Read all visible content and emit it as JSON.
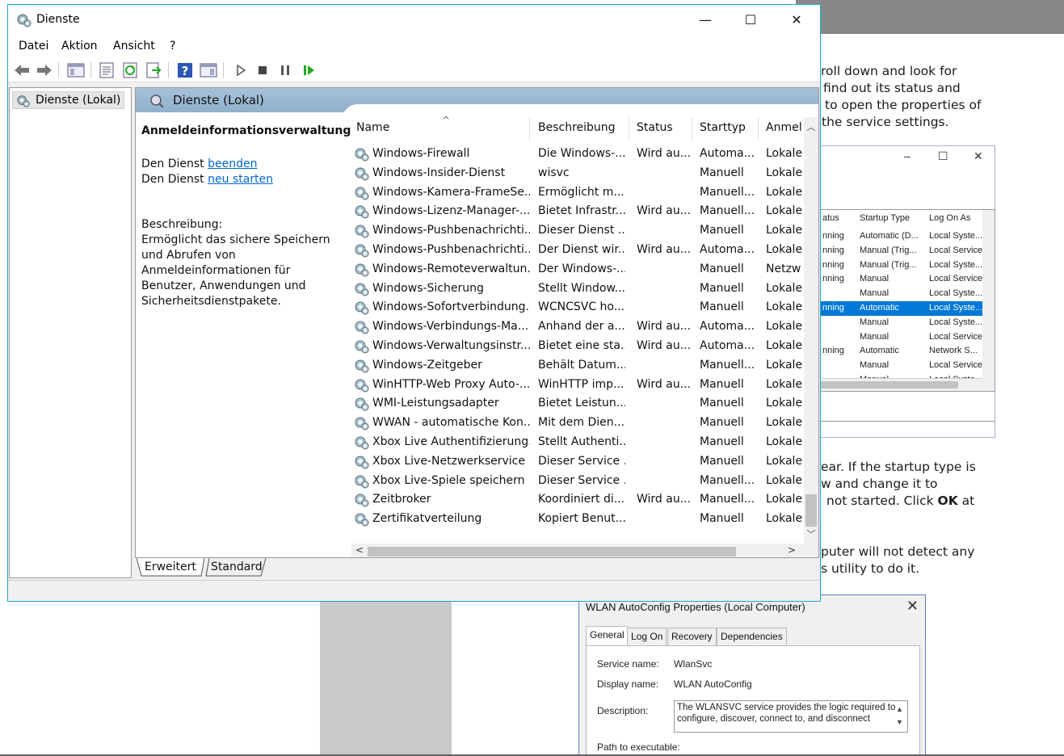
{
  "background": {
    "text_lines_top": [
      "roll down and look for",
      "find out its status and",
      "to open the properties of",
      "the service settings."
    ],
    "text_lines_mid_a": "ear. If the startup type is",
    "text_lines_mid_b": "w and change it to",
    "text_lines_mid_c_pre": "not started. Click ",
    "text_lines_mid_c_bold": "OK",
    "text_lines_mid_c_post": " at",
    "text_lines_bottom": [
      "puter will not detect any",
      "s utility to do it."
    ],
    "mini_window": {
      "controls": [
        "–",
        "☐",
        "✕"
      ],
      "headers": [
        "atus",
        "Startup Type",
        "Log On As"
      ],
      "rows": [
        {
          "status": "nning",
          "startup": "Automatic (D...",
          "logon": "Local Syste..."
        },
        {
          "status": "nning",
          "startup": "Manual (Trig...",
          "logon": "Local Service"
        },
        {
          "status": "nning",
          "startup": "Manual (Trig...",
          "logon": "Local Syste..."
        },
        {
          "status": "nning",
          "startup": "Manual",
          "logon": "Local Service"
        },
        {
          "status": "",
          "startup": "Manual",
          "logon": "Local Syste..."
        },
        {
          "status": "nning",
          "startup": "Automatic",
          "logon": "Local Syste..."
        },
        {
          "status": "",
          "startup": "Manual",
          "logon": "Local Syste..."
        },
        {
          "status": "",
          "startup": "Manual",
          "logon": "Local Service"
        },
        {
          "status": "nning",
          "startup": "Automatic",
          "logon": "Network S..."
        },
        {
          "status": "",
          "startup": "Manual",
          "logon": "Local Service"
        },
        {
          "status": "",
          "startup": "Manual",
          "logon": "Local Syste..."
        }
      ],
      "selected_index": 5
    },
    "wlan_dialog": {
      "title": "WLAN AutoConfig Properties (Local Computer)",
      "close": "✕",
      "tabs": [
        "General",
        "Log On",
        "Recovery",
        "Dependencies"
      ],
      "service_name_label": "Service name:",
      "service_name_value": "WlanSvc",
      "display_name_label": "Display name:",
      "display_name_value": "WLAN AutoConfig",
      "description_label": "Description:",
      "description_value": "The WLANSVC service provides the logic required to configure, discover, connect to, and disconnect",
      "path_label": "Path to executable:"
    }
  },
  "window": {
    "title": "Dienste",
    "minimize": "—",
    "maximize": "☐",
    "close": "✕",
    "accent": "#1aa8c7"
  },
  "menu": [
    "Datei",
    "Aktion",
    "Ansicht",
    "?"
  ],
  "tree": {
    "root_label": "Dienste (Lokal)"
  },
  "pane": {
    "header": "Dienste (Lokal)",
    "detail": {
      "title": "Anmeldeinformationsverwaltung",
      "stop_prefix": "Den Dienst ",
      "stop_link": "beenden",
      "restart_prefix": "Den Dienst ",
      "restart_link": "neu starten",
      "desc_label": "Beschreibung:",
      "desc_text": "Ermöglicht das sichere Speichern und Abrufen von Anmeldeinformationen für Benutzer, Anwendungen und Sicherheitsdienstpakete."
    }
  },
  "list": {
    "columns": [
      "Name",
      "Beschreibung",
      "Status",
      "Starttyp",
      "Anmel"
    ],
    "rows": [
      {
        "name": "Windows-Firewall",
        "desc": "Die Windows-...",
        "status": "Wird au...",
        "start": "Automa...",
        "logon": "Lokale"
      },
      {
        "name": "Windows-Insider-Dienst",
        "desc": "wisvc",
        "status": "",
        "start": "Manuell",
        "logon": "Lokale"
      },
      {
        "name": "Windows-Kamera-FrameSe...",
        "desc": "Ermöglicht m...",
        "status": "",
        "start": "Manuell...",
        "logon": "Lokale"
      },
      {
        "name": "Windows-Lizenz-Manager-...",
        "desc": "Bietet Infrastr...",
        "status": "Wird au...",
        "start": "Manuell...",
        "logon": "Lokale"
      },
      {
        "name": "Windows-Pushbenachrichti...",
        "desc": "Dieser Dienst ...",
        "status": "",
        "start": "Manuell",
        "logon": "Lokale"
      },
      {
        "name": "Windows-Pushbenachrichti...",
        "desc": "Der Dienst wir...",
        "status": "Wird au...",
        "start": "Automa...",
        "logon": "Lokale"
      },
      {
        "name": "Windows-Remoteverwaltun...",
        "desc": "Der Windows-...",
        "status": "",
        "start": "Manuell",
        "logon": "Netzw"
      },
      {
        "name": "Windows-Sicherung",
        "desc": "Stellt Window...",
        "status": "",
        "start": "Manuell",
        "logon": "Lokale"
      },
      {
        "name": "Windows-Sofortverbindung...",
        "desc": "WCNCSVC ho...",
        "status": "",
        "start": "Manuell",
        "logon": "Lokale"
      },
      {
        "name": "Windows-Verbindungs-Ma...",
        "desc": "Anhand der a...",
        "status": "Wird au...",
        "start": "Automa...",
        "logon": "Lokale"
      },
      {
        "name": "Windows-Verwaltungsinstr...",
        "desc": "Bietet eine sta...",
        "status": "Wird au...",
        "start": "Automa...",
        "logon": "Lokale"
      },
      {
        "name": "Windows-Zeitgeber",
        "desc": "Behält Datum...",
        "status": "",
        "start": "Manuell...",
        "logon": "Lokale"
      },
      {
        "name": "WinHTTP-Web Proxy Auto-...",
        "desc": "WinHTTP imp...",
        "status": "Wird au...",
        "start": "Manuell",
        "logon": "Lokale"
      },
      {
        "name": "WMI-Leistungsadapter",
        "desc": "Bietet Leistun...",
        "status": "",
        "start": "Manuell",
        "logon": "Lokale"
      },
      {
        "name": "WWAN - automatische Kon...",
        "desc": "Mit dem Dien...",
        "status": "",
        "start": "Manuell",
        "logon": "Lokale"
      },
      {
        "name": "Xbox Live Authentifizierung...",
        "desc": "Stellt Authenti...",
        "status": "",
        "start": "Manuell",
        "logon": "Lokale"
      },
      {
        "name": "Xbox Live-Netzwerkservice",
        "desc": "Dieser Service ...",
        "status": "",
        "start": "Manuell",
        "logon": "Lokale"
      },
      {
        "name": "Xbox Live-Spiele speichern",
        "desc": "Dieser Service ...",
        "status": "",
        "start": "Manuell...",
        "logon": "Lokale"
      },
      {
        "name": "Zeitbroker",
        "desc": "Koordiniert di...",
        "status": "Wird au...",
        "start": "Manuell...",
        "logon": "Lokale"
      },
      {
        "name": "Zertifikatverteilung",
        "desc": "Kopiert Benut...",
        "status": "",
        "start": "Manuell",
        "logon": "Lokale"
      }
    ]
  },
  "view_tabs": [
    "Erweitert",
    "Standard"
  ],
  "active_view_tab": "Erweitert"
}
